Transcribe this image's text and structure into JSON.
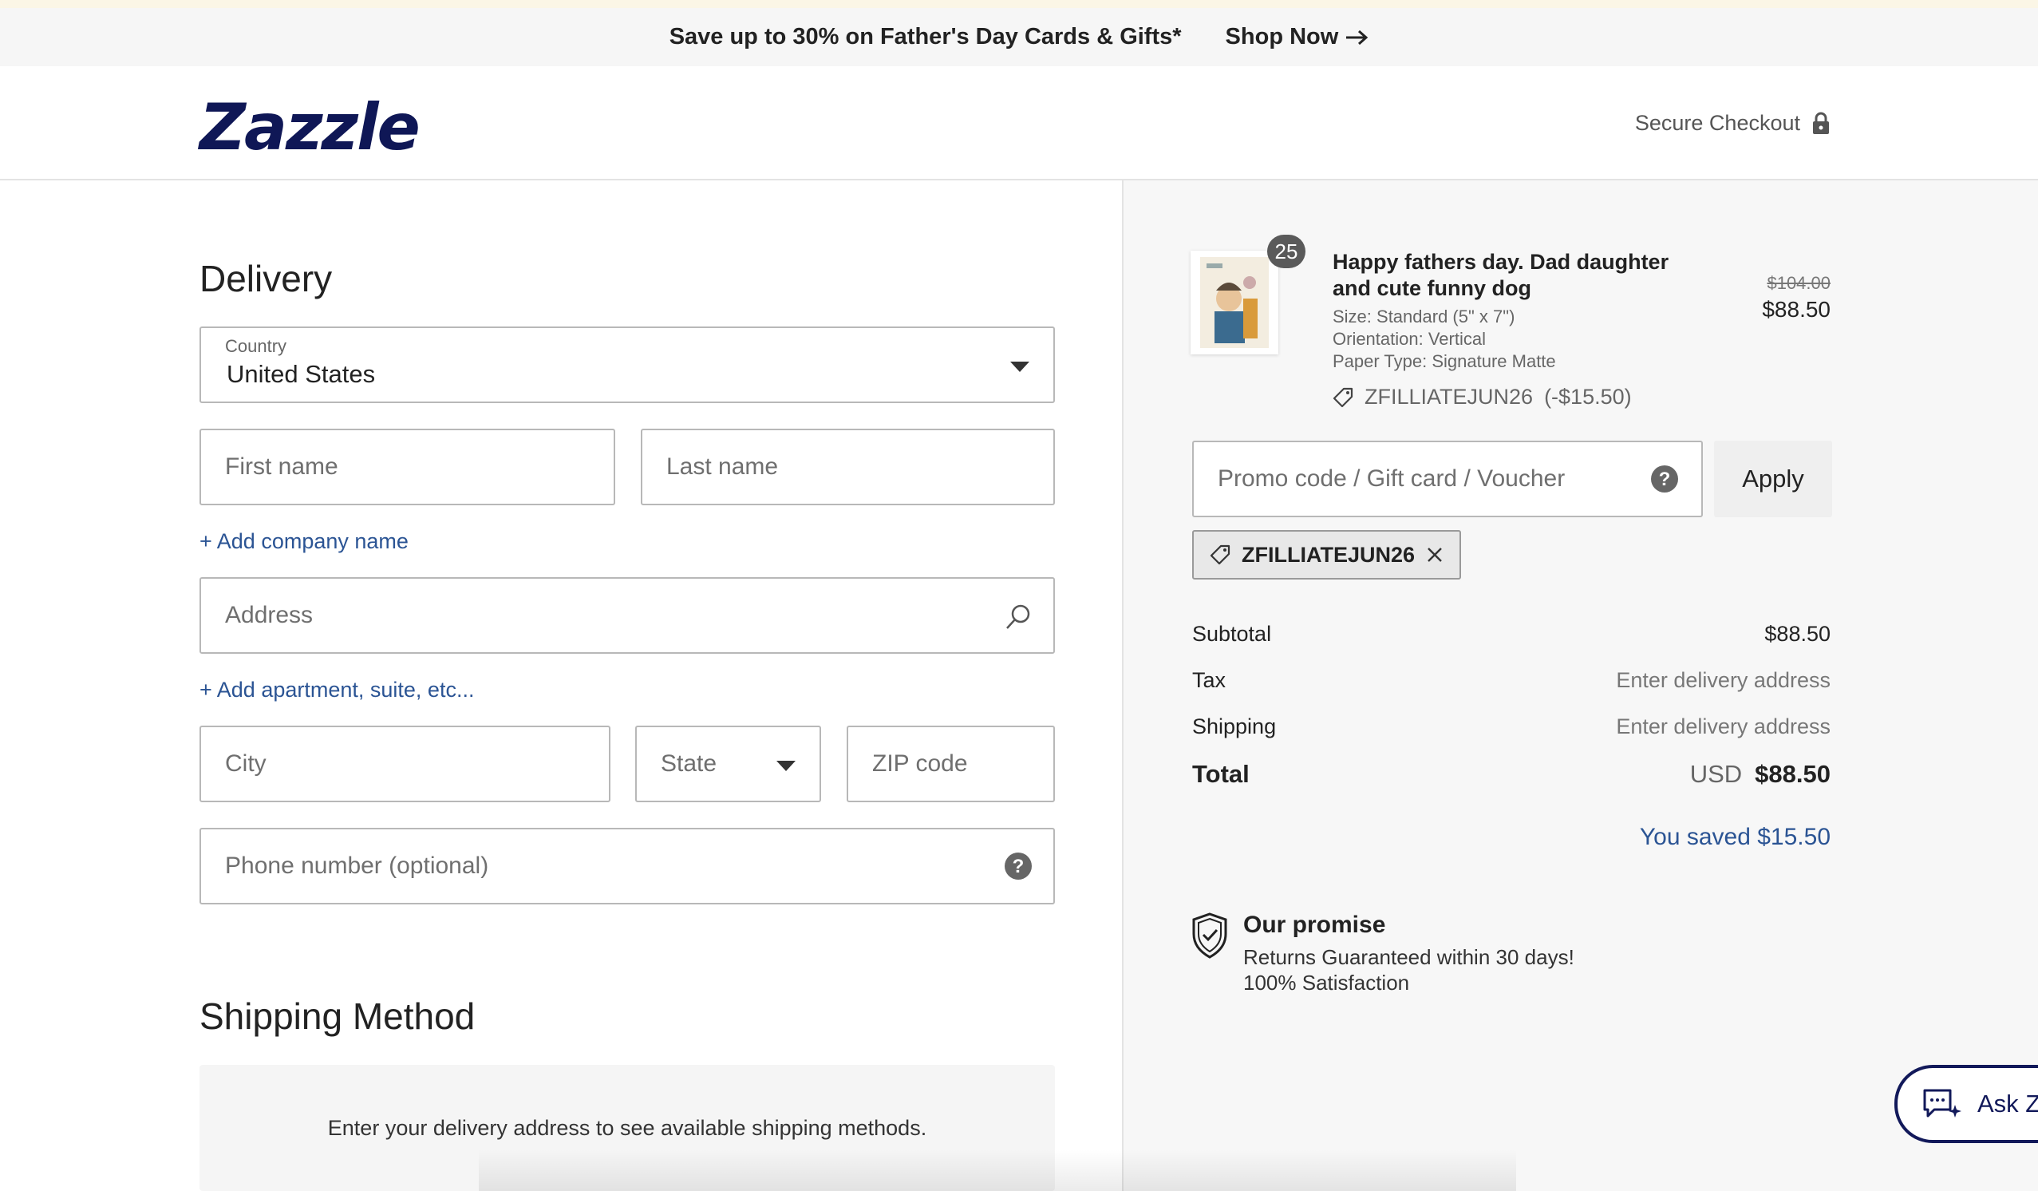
{
  "promo_bar": {
    "text": "Save up to 30% on Father's Day Cards & Gifts*",
    "cta": "Shop Now"
  },
  "header": {
    "logo": "Zazzle",
    "secure_checkout": "Secure Checkout"
  },
  "delivery": {
    "heading": "Delivery",
    "country": {
      "label": "Country",
      "value": "United States"
    },
    "first_name": {
      "placeholder": "First name"
    },
    "last_name": {
      "placeholder": "Last name"
    },
    "add_company": "+ Add company name",
    "address": {
      "placeholder": "Address"
    },
    "add_apartment": "+ Add apartment, suite, etc...",
    "city": {
      "placeholder": "City"
    },
    "state": {
      "placeholder": "State"
    },
    "zip": {
      "placeholder": "ZIP code"
    },
    "phone": {
      "placeholder": "Phone number (optional)"
    }
  },
  "shipping": {
    "heading": "Shipping Method",
    "message": "Enter your delivery address to see available shipping methods."
  },
  "order": {
    "item": {
      "quantity": "25",
      "title": "Happy fathers day. Dad daughter and cute funny dog",
      "size": "Size: Standard (5\" x 7\")",
      "orientation": "Orientation: Vertical",
      "paper": "Paper Type: Signature Matte",
      "coupon": "ZFILLIATEJUN26",
      "coupon_discount": "(-$15.50)",
      "original_price": "$104.00",
      "price": "$88.50"
    },
    "promo_input": {
      "placeholder": "Promo code / Gift card / Voucher"
    },
    "apply_label": "Apply",
    "applied_code": "ZFILLIATEJUN26",
    "summary": {
      "subtotal_label": "Subtotal",
      "subtotal_value": "$88.50",
      "tax_label": "Tax",
      "tax_value": "Enter delivery address",
      "shipping_label": "Shipping",
      "shipping_value": "Enter delivery address",
      "total_label": "Total",
      "total_currency": "USD",
      "total_value": "$88.50",
      "saved": "You saved $15.50"
    },
    "promise": {
      "title": "Our promise",
      "line1": "Returns Guaranteed within 30 days!",
      "line2": "100% Satisfaction"
    }
  },
  "assistant": {
    "label": "Ask Z"
  },
  "colors": {
    "brand_navy": "#0f1756",
    "link_blue": "#2b5494",
    "promo_bg": "#f6f6f6",
    "summary_bg": "#f7f7f7"
  }
}
